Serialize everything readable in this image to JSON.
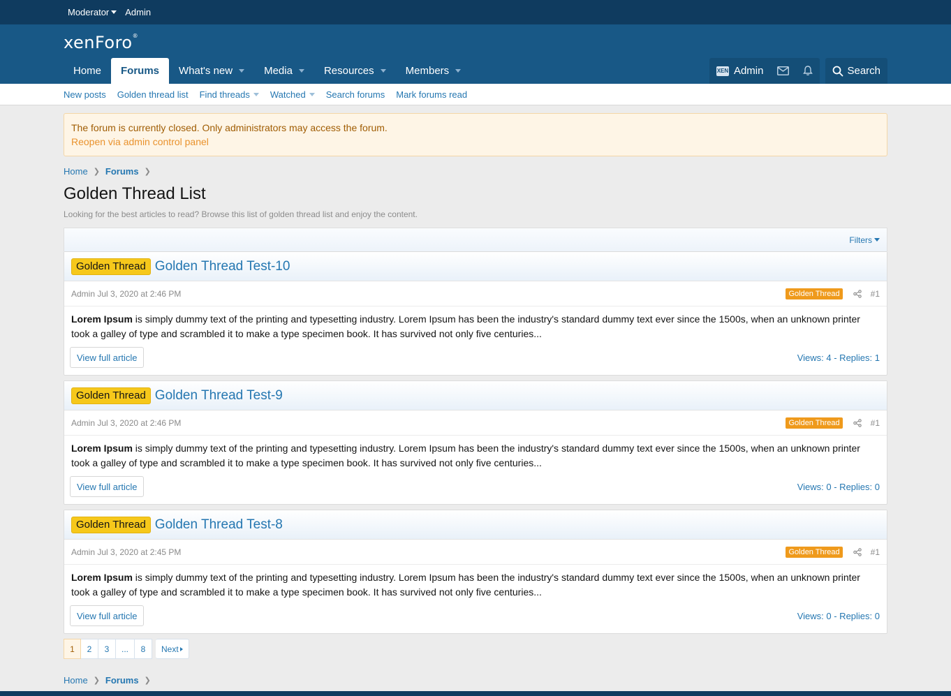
{
  "staffbar": {
    "moderator": "Moderator",
    "admin": "Admin"
  },
  "header": {
    "logo": "xenForo",
    "logo_mark": "®"
  },
  "nav": {
    "home": "Home",
    "forums": "Forums",
    "whats_new": "What's new",
    "media": "Media",
    "resources": "Resources",
    "members": "Members",
    "account": "Admin",
    "avatar_text": "XEN",
    "search": "Search"
  },
  "subnav": {
    "new_posts": "New posts",
    "golden_list": "Golden thread list",
    "find_threads": "Find threads",
    "watched": "Watched",
    "search_forums": "Search forums",
    "mark_read": "Mark forums read"
  },
  "notice": {
    "message": "The forum is currently closed. Only administrators may access the forum.",
    "link": "Reopen via admin control panel"
  },
  "breadcrumb": {
    "home": "Home",
    "forums": "Forums"
  },
  "page": {
    "title": "Golden Thread List",
    "description": "Looking for the best articles to read? Browse this list of golden thread list and enjoy the content."
  },
  "filters": {
    "label": "Filters"
  },
  "threads": [
    {
      "label": "Golden Thread",
      "title": "Golden Thread Test-10",
      "meta": "Admin Jul 3, 2020 at 2:46 PM",
      "mini_label": "Golden Thread",
      "post_num": "#1",
      "body_bold": "Lorem Ipsum",
      "body": " is simply dummy text of the printing and typesetting industry. Lorem Ipsum has been the industry's standard dummy text ever since the 1500s, when an unknown printer took a galley of type and scrambled it to make a type specimen book. It has survived not only five centuries...",
      "button": "View full article",
      "stats": "Views: 4 - Replies: 1"
    },
    {
      "label": "Golden Thread",
      "title": "Golden Thread Test-9",
      "meta": "Admin Jul 3, 2020 at 2:46 PM",
      "mini_label": "Golden Thread",
      "post_num": "#1",
      "body_bold": "Lorem Ipsum",
      "body": " is simply dummy text of the printing and typesetting industry. Lorem Ipsum has been the industry's standard dummy text ever since the 1500s, when an unknown printer took a galley of type and scrambled it to make a type specimen book. It has survived not only five centuries...",
      "button": "View full article",
      "stats": "Views: 0 - Replies: 0"
    },
    {
      "label": "Golden Thread",
      "title": "Golden Thread Test-8",
      "meta": "Admin Jul 3, 2020 at 2:45 PM",
      "mini_label": "Golden Thread",
      "post_num": "#1",
      "body_bold": "Lorem Ipsum",
      "body": " is simply dummy text of the printing and typesetting industry. Lorem Ipsum has been the industry's standard dummy text ever since the 1500s, when an unknown printer took a galley of type and scrambled it to make a type specimen book. It has survived not only five centuries...",
      "button": "View full article",
      "stats": "Views: 0 - Replies: 0"
    }
  ],
  "pagination": {
    "p1": "1",
    "p2": "2",
    "p3": "3",
    "ellipsis": "...",
    "last": "8",
    "next": "Next"
  },
  "colors": {
    "staffbar": "#0f3b5f",
    "header": "#185886",
    "link": "#2577b1",
    "gold": "#f6c81b",
    "orange": "#ef9a1c"
  }
}
